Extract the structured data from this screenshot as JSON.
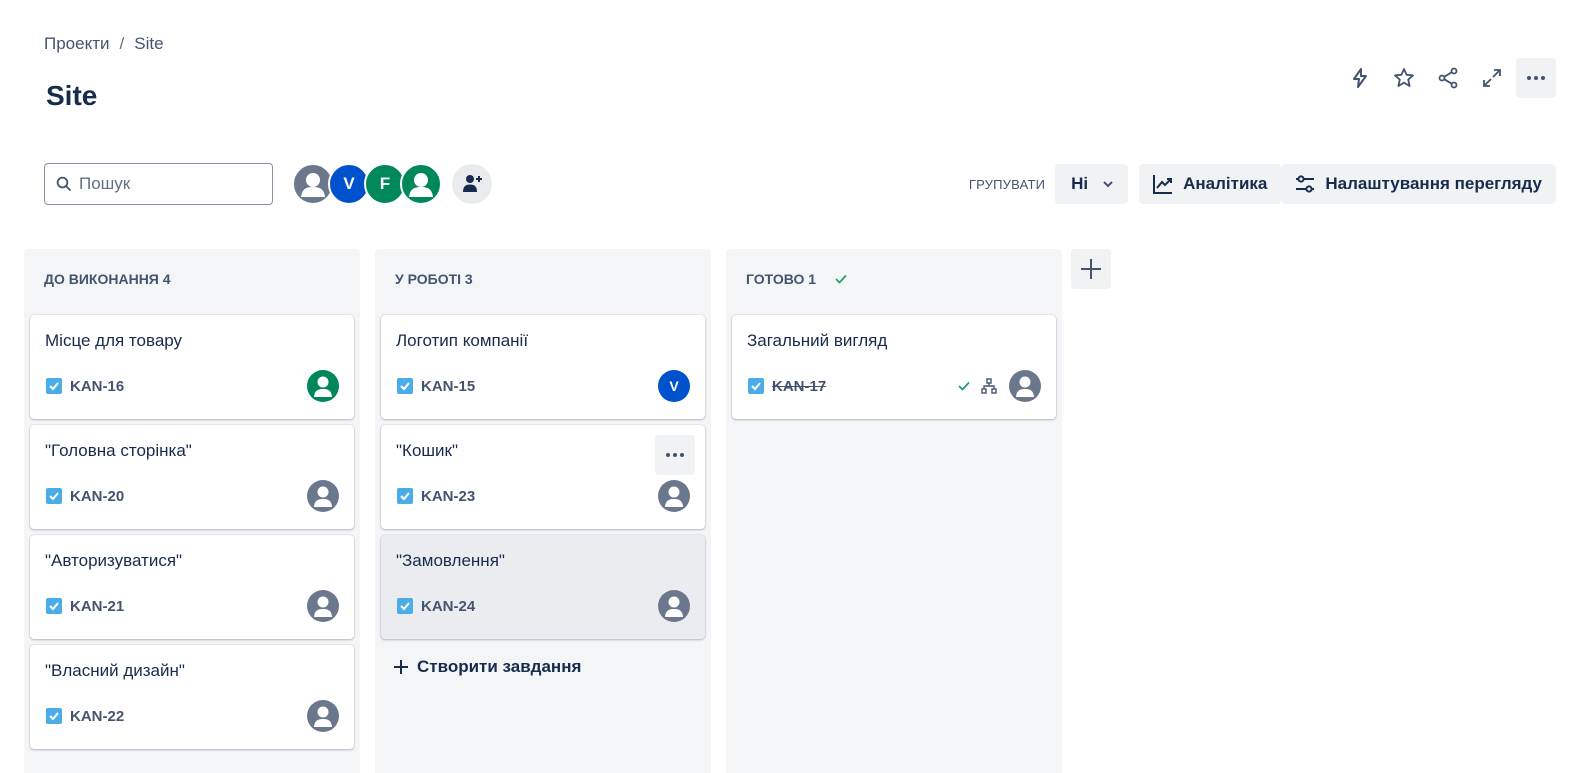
{
  "breadcrumb": {
    "projects": "Проекти",
    "separator": "/",
    "current": "Site"
  },
  "page_title": "Site",
  "search": {
    "placeholder": "Пошук",
    "value": ""
  },
  "avatars": [
    {
      "type": "person",
      "initial": ""
    },
    {
      "type": "letter",
      "initial": "V"
    },
    {
      "type": "letter",
      "initial": "F"
    },
    {
      "type": "person",
      "initial": ""
    }
  ],
  "grouping": {
    "label": "ГРУПУВАТИ",
    "value": "Ні"
  },
  "tools": {
    "analytics": "Аналітика",
    "view_settings": "Налаштування перегляду"
  },
  "colors": {
    "accent": "#0052cc",
    "done": "#22a06b",
    "story": "#4bade8",
    "green_avatar": "#00875a",
    "gray_avatar": "#6b778c"
  },
  "columns": [
    {
      "title": "ДО ВИКОНАННЯ 4",
      "cards": [
        {
          "title": "Місце для товару",
          "key": "KAN-16",
          "assignee": "green-person"
        },
        {
          "title": "\"Головна сторінка\"",
          "key": "KAN-20",
          "assignee": "gray-person"
        },
        {
          "title": "\"Авторизуватися\"",
          "key": "KAN-21",
          "assignee": "gray-person"
        },
        {
          "title": "\"Власний дизайн\"",
          "key": "KAN-22",
          "assignee": "gray-person"
        }
      ]
    },
    {
      "title": "У РОБОТІ 3",
      "cards": [
        {
          "title": "Логотип компанії",
          "key": "KAN-15",
          "assignee": "V"
        },
        {
          "title": "\"Кошик\"",
          "key": "KAN-23",
          "assignee": "gray-person"
        },
        {
          "title": "\"Замовлення\"",
          "key": "KAN-24",
          "assignee": "gray-person"
        }
      ],
      "create_label": "Створити завдання"
    },
    {
      "title": "ГОТОВО 1",
      "cards": [
        {
          "title": "Загальний вигляд",
          "key": "KAN-17",
          "assignee": "gray-person"
        }
      ]
    }
  ]
}
